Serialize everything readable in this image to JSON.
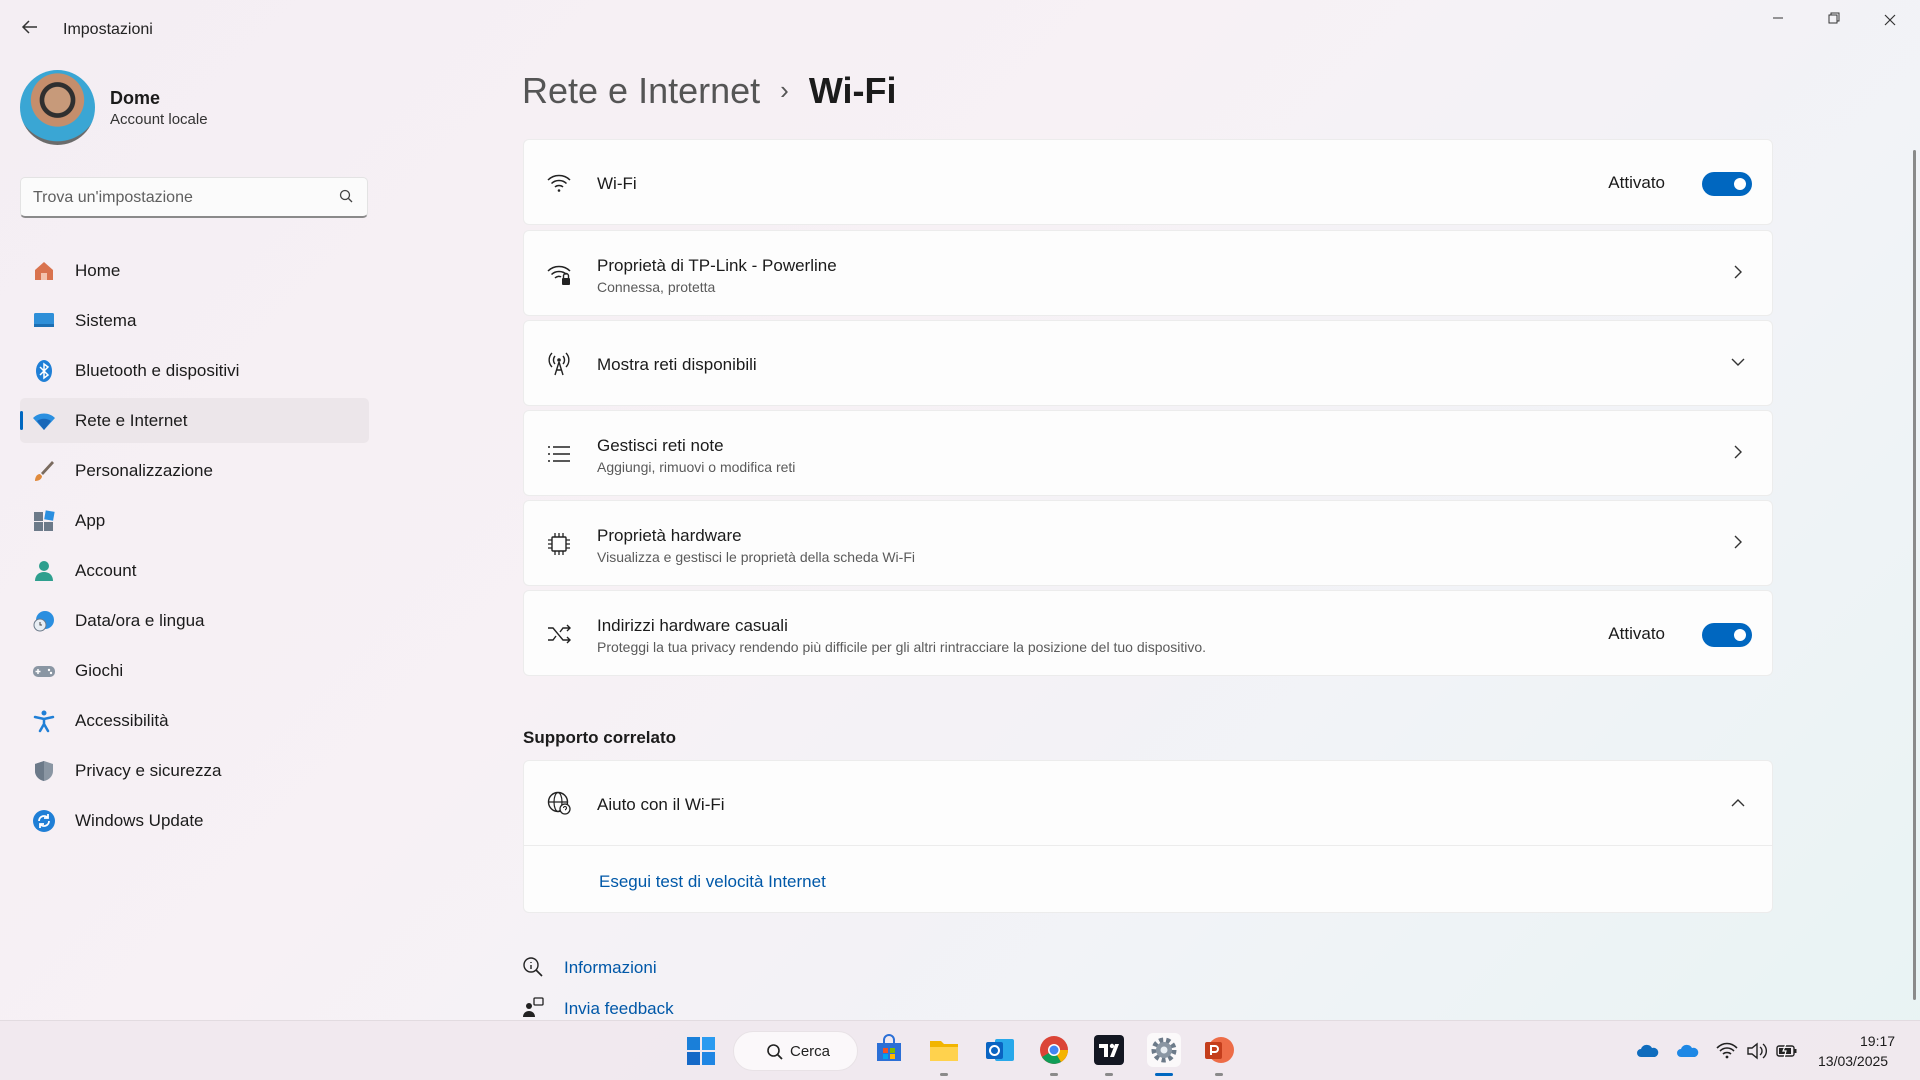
{
  "titlebar": {
    "app_title": "Impostazioni",
    "back_icon": "arrow-left-icon",
    "minimize_icon": "minimize-icon",
    "maximize_icon": "restore-icon",
    "close_icon": "close-icon"
  },
  "profile": {
    "name": "Dome",
    "account_type": "Account locale"
  },
  "search": {
    "placeholder": "Trova un'impostazione"
  },
  "sidebar": {
    "items": [
      {
        "label": "Home",
        "icon": "home-icon"
      },
      {
        "label": "Sistema",
        "icon": "system-icon"
      },
      {
        "label": "Bluetooth e dispositivi",
        "icon": "bluetooth-icon"
      },
      {
        "label": "Rete e Internet",
        "icon": "network-icon",
        "selected": true
      },
      {
        "label": "Personalizzazione",
        "icon": "brush-icon"
      },
      {
        "label": "App",
        "icon": "apps-icon"
      },
      {
        "label": "Account",
        "icon": "account-icon"
      },
      {
        "label": "Data/ora e lingua",
        "icon": "time-language-icon"
      },
      {
        "label": "Giochi",
        "icon": "gamepad-icon"
      },
      {
        "label": "Accessibilità",
        "icon": "accessibility-icon"
      },
      {
        "label": "Privacy e sicurezza",
        "icon": "shield-icon"
      },
      {
        "label": "Windows Update",
        "icon": "update-icon"
      }
    ]
  },
  "breadcrumb": {
    "parent": "Rete e Internet",
    "separator": "›",
    "current": "Wi-Fi"
  },
  "settings": {
    "wifi": {
      "title": "Wi-Fi",
      "toggle_label": "Attivato",
      "on": true
    },
    "properties": {
      "title": "Proprietà di TP-Link - Powerline",
      "subtitle": "Connessa, protetta"
    },
    "available": {
      "title": "Mostra reti disponibili"
    },
    "known": {
      "title": "Gestisci reti note",
      "subtitle": "Aggiungi, rimuovi o modifica reti"
    },
    "hardware": {
      "title": "Proprietà hardware",
      "subtitle": "Visualizza e gestisci le proprietà della scheda Wi-Fi"
    },
    "random": {
      "title": "Indirizzi hardware casuali",
      "subtitle": "Proteggi la tua privacy rendendo più difficile per gli altri rintracciare la posizione del tuo dispositivo.",
      "toggle_label": "Attivato",
      "on": true
    }
  },
  "related": {
    "section_title": "Supporto correlato",
    "help_title": "Aiuto con il Wi-Fi",
    "help_link": "Esegui test di velocità Internet"
  },
  "footer": {
    "info": "Informazioni",
    "feedback": "Invia feedback"
  },
  "taskbar": {
    "search_label": "Cerca",
    "apps": [
      "start-icon",
      "store-icon",
      "file-explorer-icon",
      "outlook-icon",
      "chrome-icon",
      "tradingview-icon",
      "settings-icon",
      "powerpoint-icon"
    ],
    "time": "19:17",
    "date": "13/03/2025"
  },
  "colors": {
    "accent": "#0067c0",
    "link": "#0058a8"
  }
}
